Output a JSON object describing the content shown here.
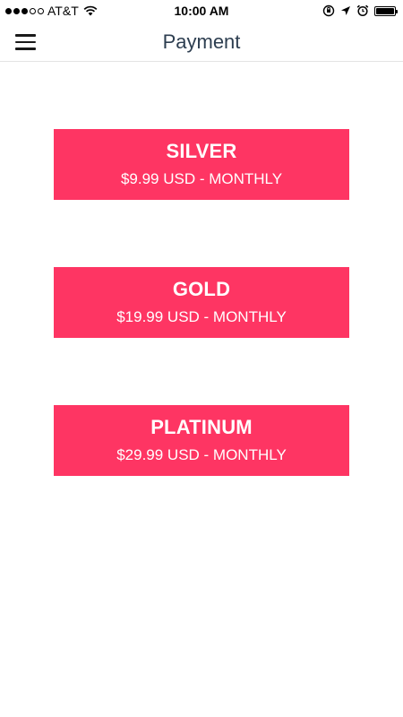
{
  "status_bar": {
    "carrier": "AT&T",
    "time": "10:00 AM",
    "signal_bars_filled": 3,
    "signal_bars_total": 5
  },
  "header": {
    "title": "Payment",
    "menu_icon": "hamburger-menu-icon"
  },
  "colors": {
    "plan_background": "#fe3563",
    "title_color": "#2d3e50"
  },
  "plans": [
    {
      "name": "SILVER",
      "price": "$9.99 USD - MONTHLY"
    },
    {
      "name": "GOLD",
      "price": "$19.99 USD - MONTHLY"
    },
    {
      "name": "PLATINUM",
      "price": "$29.99 USD - MONTHLY"
    }
  ]
}
